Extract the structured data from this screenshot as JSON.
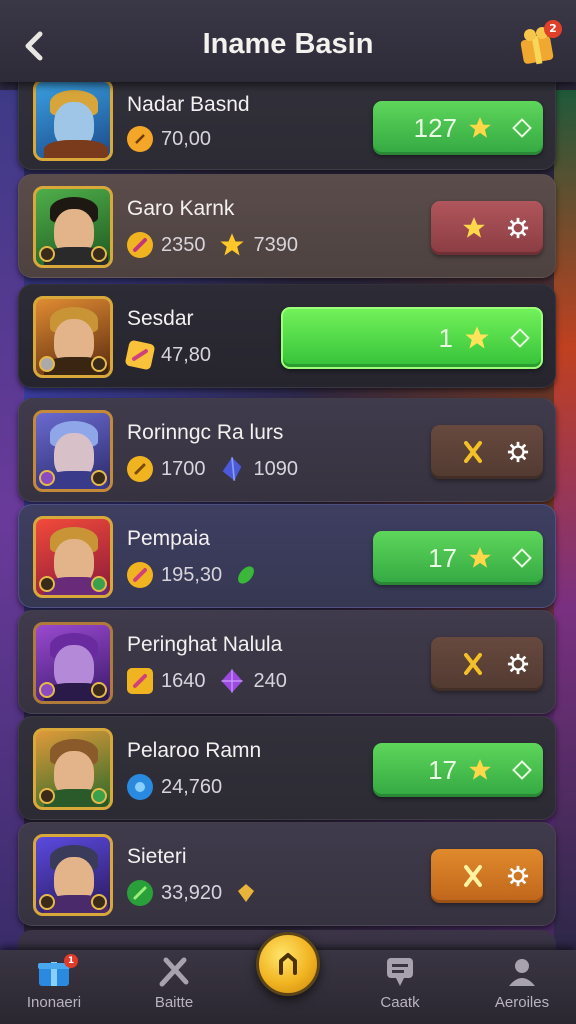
{
  "header": {
    "title": "Iname Basin",
    "gift_badge": "2"
  },
  "rows": [
    {
      "name": "Nadar Basnd",
      "stat1": "70,00",
      "stat2": "",
      "action_count": "127",
      "action_style": "green",
      "theme": "blue-hero"
    },
    {
      "name": "Garo Karnk",
      "stat1": "2350",
      "stat2": "7390",
      "action_count": "",
      "action_style": "red",
      "theme": "green-hero"
    },
    {
      "name": "Sesdar",
      "stat1": "47,80",
      "stat2": "",
      "action_count": "1",
      "action_style": "bright",
      "theme": "gold-hero"
    },
    {
      "name": "Rorinngc Ra lurs",
      "stat1": "1700",
      "stat2": "1090",
      "action_count": "",
      "action_style": "brown",
      "theme": "ice-hero"
    },
    {
      "name": "Pempaia",
      "stat1": "195,30",
      "stat2": "",
      "action_count": "17",
      "action_style": "green",
      "theme": "fire-hero"
    },
    {
      "name": "Peringhat Nalula",
      "stat1": "1640",
      "stat2": "240",
      "action_count": "",
      "action_style": "brown",
      "theme": "purple-hero"
    },
    {
      "name": "Pelaroo Ramn",
      "stat1": "24,760",
      "stat2": "",
      "action_count": "17",
      "action_style": "green",
      "theme": "forest-hero"
    },
    {
      "name": "Sieteri",
      "stat1": "33,920",
      "stat2": "",
      "action_count": "",
      "action_style": "orange",
      "theme": "cosmic-hero"
    }
  ],
  "nav": {
    "items": [
      {
        "label": "Inonaeri",
        "icon": "gift-box-icon",
        "badge": "1"
      },
      {
        "label": "Baitte",
        "icon": "swords-icon"
      },
      {
        "label": "",
        "icon": "home-icon"
      },
      {
        "label": "Caatk",
        "icon": "chat-icon"
      },
      {
        "label": "Aeroiles",
        "icon": "profile-icon"
      }
    ]
  },
  "colors": {
    "green": "#33a843",
    "gold": "#f1b421",
    "accent_red": "#e0402a"
  }
}
